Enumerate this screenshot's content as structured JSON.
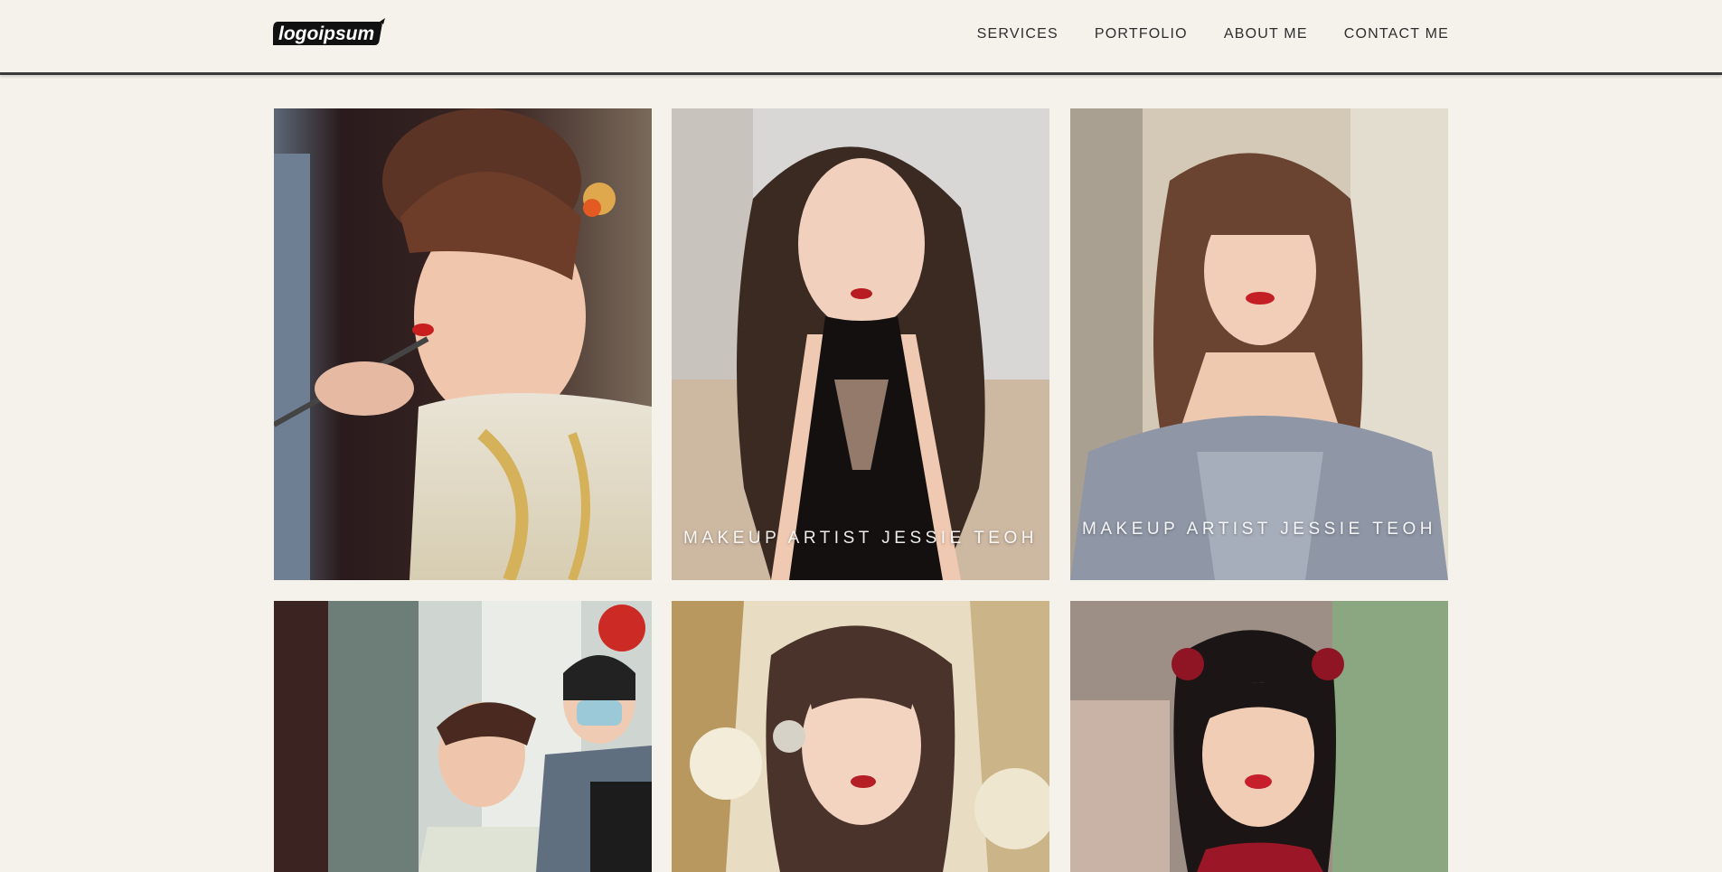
{
  "nav": {
    "items": [
      {
        "label": "SERVICES"
      },
      {
        "label": "PORTFOLIO"
      },
      {
        "label": "ABOUT ME"
      },
      {
        "label": "CONTACT ME"
      }
    ]
  },
  "logo": {
    "text": "logoipsum"
  },
  "gallery": {
    "captions": {
      "tile_2": "MAKEUP ARTIST JESSIE TEOH",
      "tile_3": "MAKEUP ARTIST JESSIE TEOH"
    }
  },
  "colors": {
    "background": "#f5f2ec",
    "header_rule": "#3a3a3a",
    "nav_text": "#2e2e2e"
  }
}
